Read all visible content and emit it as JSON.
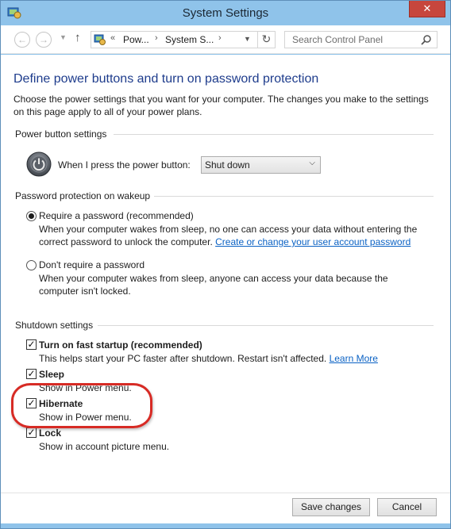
{
  "window": {
    "title": "System Settings",
    "close_label": "✕"
  },
  "nav": {
    "breadcrumb": [
      "Pow...",
      "System S..."
    ],
    "breadcrumb_lead": "«",
    "search_placeholder": "Search Control Panel"
  },
  "main": {
    "heading": "Define power buttons and turn on password protection",
    "description": "Choose the power settings that you want for your computer. The changes you make to the settings on this page apply to all of your power plans.",
    "power_section": {
      "title": "Power button settings",
      "label": "When I press the power button:",
      "selected": "Shut down"
    },
    "password_section": {
      "title": "Password protection on wakeup",
      "option1_label": "Require a password (recommended)",
      "option1_desc": "When your computer wakes from sleep, no one can access your data without entering the correct password to unlock the computer.",
      "option1_link": "Create or change your user account password",
      "option2_label": "Don't require a password",
      "option2_desc": "When your computer wakes from sleep, anyone can access your data because the computer isn't locked.",
      "selected_option": 1
    },
    "shutdown_section": {
      "title": "Shutdown settings",
      "items": [
        {
          "label": "Turn on fast startup (recommended)",
          "desc": "This helps start your PC faster after shutdown. Restart isn't affected.",
          "link": "Learn More",
          "checked": true
        },
        {
          "label": "Sleep",
          "desc": "Show in Power menu.",
          "checked": true
        },
        {
          "label": "Hibernate",
          "desc": "Show in Power menu.",
          "checked": true
        },
        {
          "label": "Lock",
          "desc": "Show in account picture menu.",
          "checked": true
        }
      ]
    }
  },
  "footer": {
    "save_label": "Save changes",
    "cancel_label": "Cancel"
  },
  "colors": {
    "chrome": "#8fc3ea",
    "heading": "#1e3c8c",
    "link": "#0b62c4",
    "highlight": "#d72b25",
    "close": "#c7463d"
  }
}
